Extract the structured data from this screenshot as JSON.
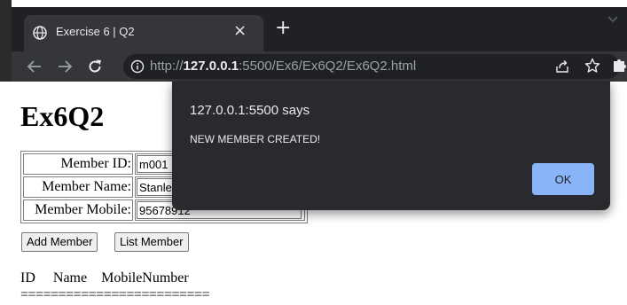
{
  "browser": {
    "tab": {
      "title": "Exercise 6 | Q2",
      "close_glyph": "×",
      "favicon": "globe-icon"
    },
    "new_tab_glyph": "+",
    "url": {
      "scheme": "http://",
      "host": "127.0.0.1",
      "rest": ":5500/Ex6/Ex6Q2/Ex6Q2.html"
    },
    "icons": [
      "back-arrow-icon",
      "forward-arrow-icon",
      "reload-icon",
      "info-icon",
      "share-icon",
      "star-icon",
      "extensions-icon",
      "chevron-down-icon"
    ]
  },
  "page": {
    "title": "Ex6Q2",
    "form": {
      "member_id_label": "Member ID:",
      "member_id_value": "m001",
      "member_name_label": "Member Name:",
      "member_name_value": "Stanley",
      "member_mobile_label": "Member Mobile:",
      "member_mobile_value": "95678912"
    },
    "buttons": {
      "add_label": "Add Member",
      "list_label": "List Member"
    },
    "list": {
      "header": "ID     Name    MobileNumber",
      "separator": "========================="
    }
  },
  "dialog": {
    "title": "127.0.0.1:5500 says",
    "message": "NEW MEMBER CREATED!",
    "ok_label": "OK"
  },
  "colors": {
    "chrome_dark": "#202124",
    "toolbar": "#35363a",
    "dialog_bg": "#292a2d",
    "ok_button": "#8ab4f8"
  }
}
